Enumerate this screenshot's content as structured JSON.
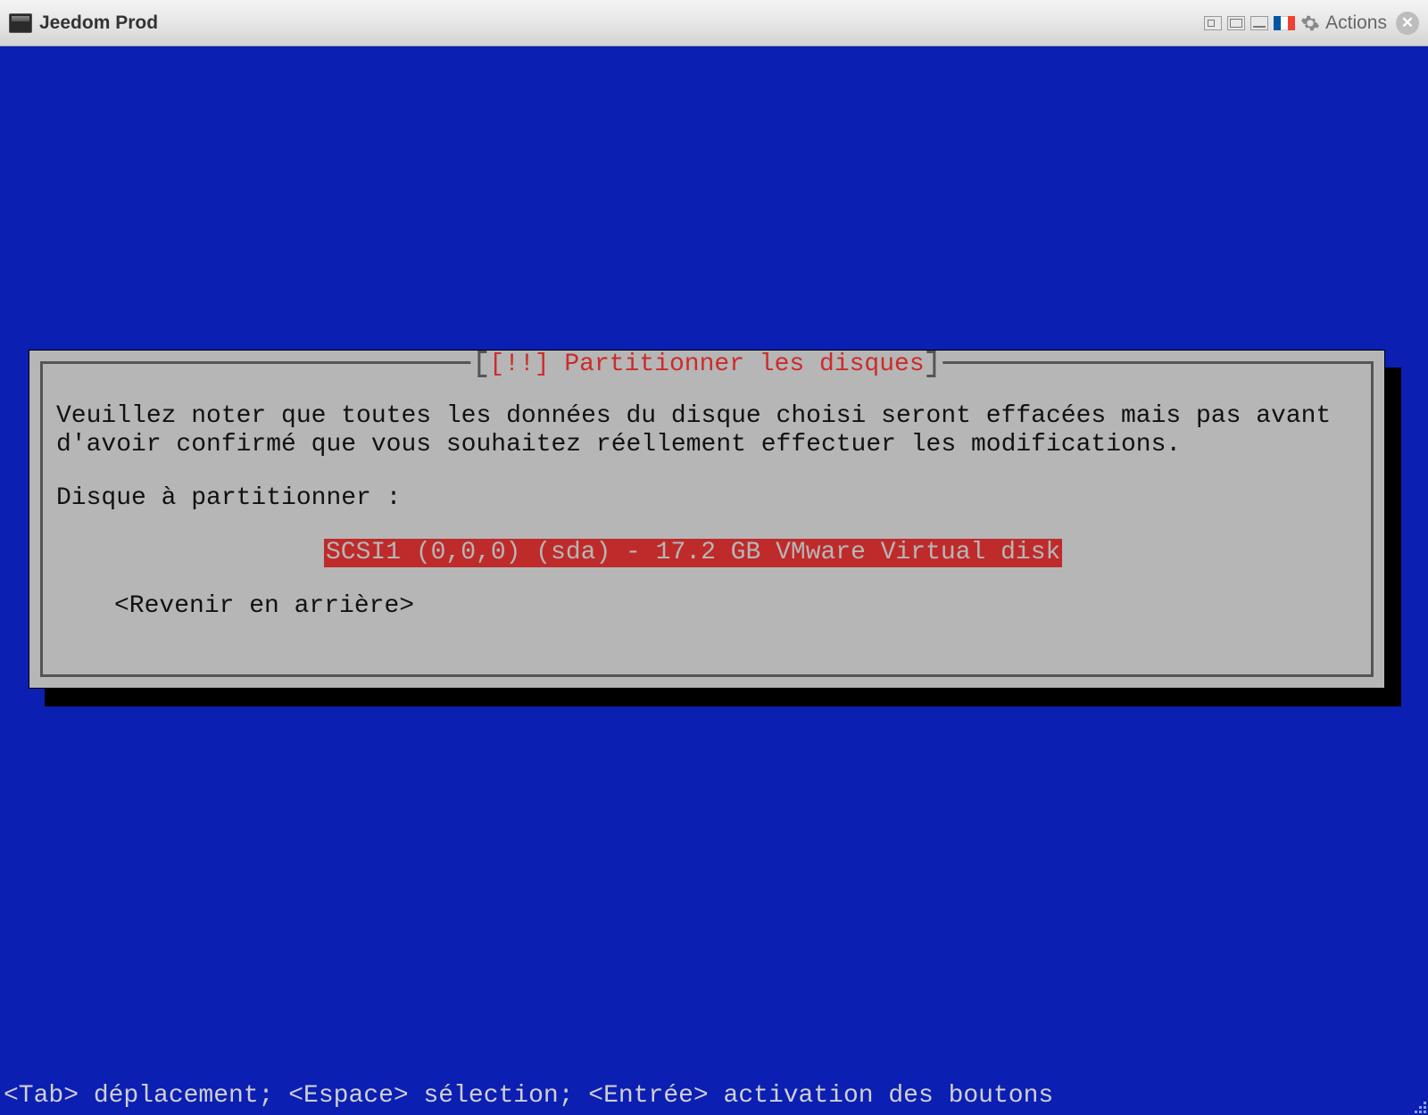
{
  "titlebar": {
    "title": "Jeedom Prod",
    "actions_label": "Actions"
  },
  "dialog": {
    "title": "[!!] Partitionner les disques",
    "warning_text": "Veuillez noter que toutes les données du disque choisi seront effacées mais pas avant d'avoir confirmé que vous souhaitez réellement effectuer les modifications.",
    "prompt_label": "Disque à partitionner :",
    "disk_option": "SCSI1 (0,0,0) (sda) - 17.2 GB VMware Virtual disk",
    "back_label": "<Revenir en arrière>"
  },
  "footer": {
    "help_text": "<Tab> déplacement; <Espace> sélection; <Entrée> activation des boutons"
  }
}
